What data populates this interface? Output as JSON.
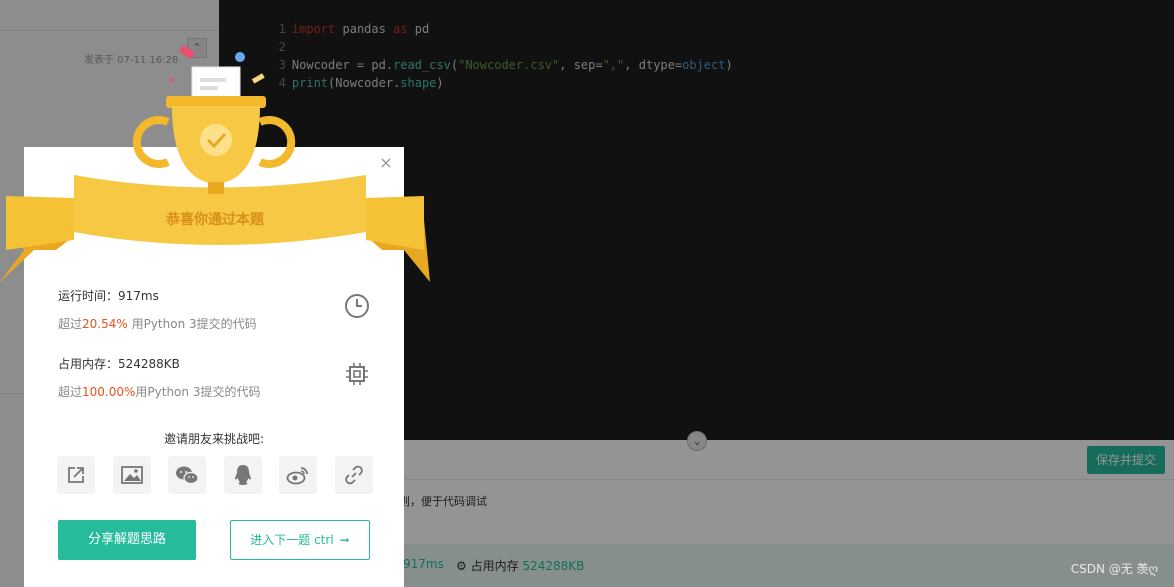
{
  "left_panel": {
    "post_time": "发表于 07-11 16:28",
    "scroll_up_glyph": "⌃"
  },
  "editor": {
    "lines": [
      {
        "n": "1"
      },
      {
        "n": "2"
      },
      {
        "n": "3"
      },
      {
        "n": "4"
      }
    ],
    "tokens": {
      "l1_import": "import",
      "l1_pandas": " pandas ",
      "l1_as": "as",
      "l1_pd": " pd",
      "l3_a": "Nowcoder = pd.",
      "l3_fn": "read_csv",
      "l3_b": "(",
      "l3_s1": "\"Nowcoder.csv\"",
      "l3_c": ", sep=",
      "l3_s2": "\",\"",
      "l3_d": ", dtype=",
      "l3_obj": "object",
      "l3_e": ")",
      "l4_print": "print",
      "l4_a": "(Nowcoder.",
      "l4_shape": "shape",
      "l4_b": ")"
    },
    "collapse_glyph": "⌄"
  },
  "bottom": {
    "save_submit": "保存并提交",
    "hint": "则，便于代码调试",
    "time_value": "917ms",
    "mem_label": "占用内存",
    "mem_value": "524288KB"
  },
  "modal": {
    "close_glyph": "×",
    "ribbon_title": "恭喜你通过本题",
    "runtime_label": "运行时间：917ms",
    "runtime_sub_prefix": "超过",
    "runtime_pct": "20.54%",
    "runtime_sub_suffix": " 用Python 3提交的代码",
    "memory_label": "占用内存：524288KB",
    "memory_sub_prefix": "超过",
    "memory_pct": "100.00%",
    "memory_sub_suffix": "用Python 3提交的代码",
    "invite": "邀请朋友来挑战吧:",
    "share_icons": [
      "share-external-icon",
      "image-icon",
      "wechat-icon",
      "qq-icon",
      "weibo-icon",
      "link-icon"
    ],
    "btn_share": "分享解题思路",
    "btn_next": "进入下一题 ctrl",
    "btn_next_arrow": "➞"
  },
  "watermark": "CSDN @无 羡ღ",
  "colors": {
    "accent": "#25bb9b",
    "highlight": "#e6531d",
    "trophy": "#f7c844"
  }
}
